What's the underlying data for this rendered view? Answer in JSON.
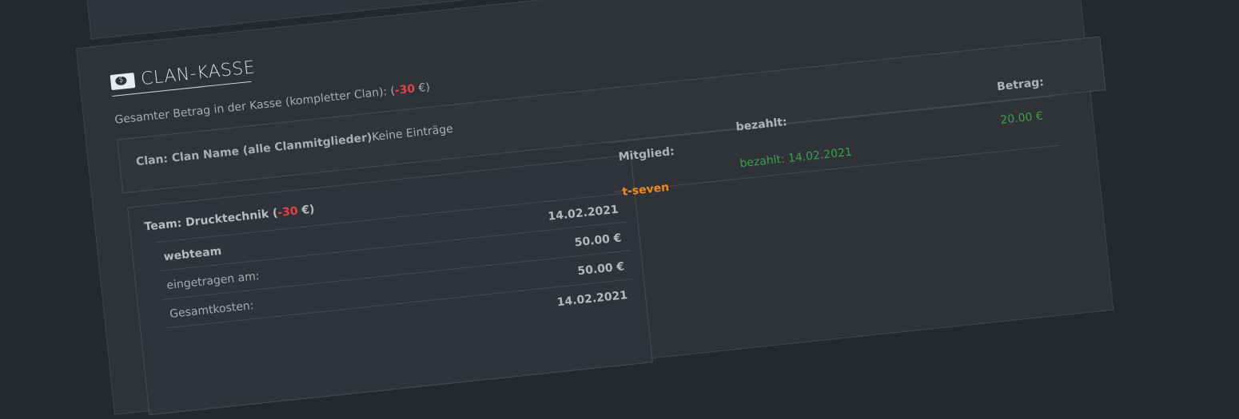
{
  "header": {
    "title": "CLAN-KASSE",
    "icon": "money-bill-icon"
  },
  "summary": {
    "prefix": "Gesamter Betrag in der Kasse (kompletter Clan): (",
    "amount": "-30",
    "suffix": " €)"
  },
  "clan": {
    "label": "Clan: Clan Name (alle Clanmitglieder)",
    "empty_text": "Keine Einträge"
  },
  "team": {
    "label_prefix": "Team: Drucktechnik (",
    "amount": "-30",
    "label_suffix": " €)",
    "rows": [
      {
        "left": "webteam",
        "right": "14.02.2021",
        "left_bold": true
      },
      {
        "left": "eingetragen am:",
        "right": "50.00 €"
      },
      {
        "left": "Gesamtkosten:",
        "right": "50.00 €"
      },
      {
        "left": "",
        "right": "14.02.2021"
      }
    ]
  },
  "payments": {
    "headers": {
      "member": "Mitglied:",
      "paid": "bezahlt:",
      "amount": "Betrag:"
    },
    "rows": [
      {
        "member": "t-seven",
        "status": "bezahlt: 14.02.2021",
        "amount": "20.00 €"
      }
    ]
  },
  "colors": {
    "background": "#25282c",
    "panel": "#2f3338",
    "negative": "#e0424b",
    "member": "#ee8a1c",
    "paid": "#3aa04a"
  }
}
